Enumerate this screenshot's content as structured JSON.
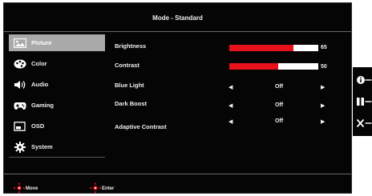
{
  "header": {
    "title": "Mode - Standard"
  },
  "sidebar": {
    "items": [
      {
        "label": "Picture",
        "icon": "picture-icon",
        "active": true
      },
      {
        "label": "Color",
        "icon": "color-palette-icon",
        "active": false
      },
      {
        "label": "Audio",
        "icon": "speaker-icon",
        "active": false
      },
      {
        "label": "Gaming",
        "icon": "gamepad-icon",
        "active": false
      },
      {
        "label": "OSD",
        "icon": "osd-window-icon",
        "active": false
      },
      {
        "label": "System",
        "icon": "gear-icon",
        "active": false
      }
    ]
  },
  "settings": {
    "brightness": {
      "label": "Brightness",
      "value": "65",
      "level": 0.72
    },
    "contrast": {
      "label": "Contrast",
      "value": "50",
      "level": 0.55
    },
    "blue_light": {
      "label": "Blue Light",
      "value": "Off"
    },
    "dark_boost": {
      "label": "Dark Boost",
      "value": "Off"
    },
    "adaptive_contrast": {
      "label": "Adaptive Contrast",
      "value": "Off"
    }
  },
  "footer": {
    "move_label": "Move",
    "enter_label": "Enter"
  },
  "side_keys": [
    "info-icon",
    "pause-bars-icon",
    "close-x-icon"
  ],
  "colors": {
    "bar_fill": "#e8101b",
    "bar_track": "#ffffff",
    "active_item": "#a9a9a9",
    "background": "#050505"
  }
}
